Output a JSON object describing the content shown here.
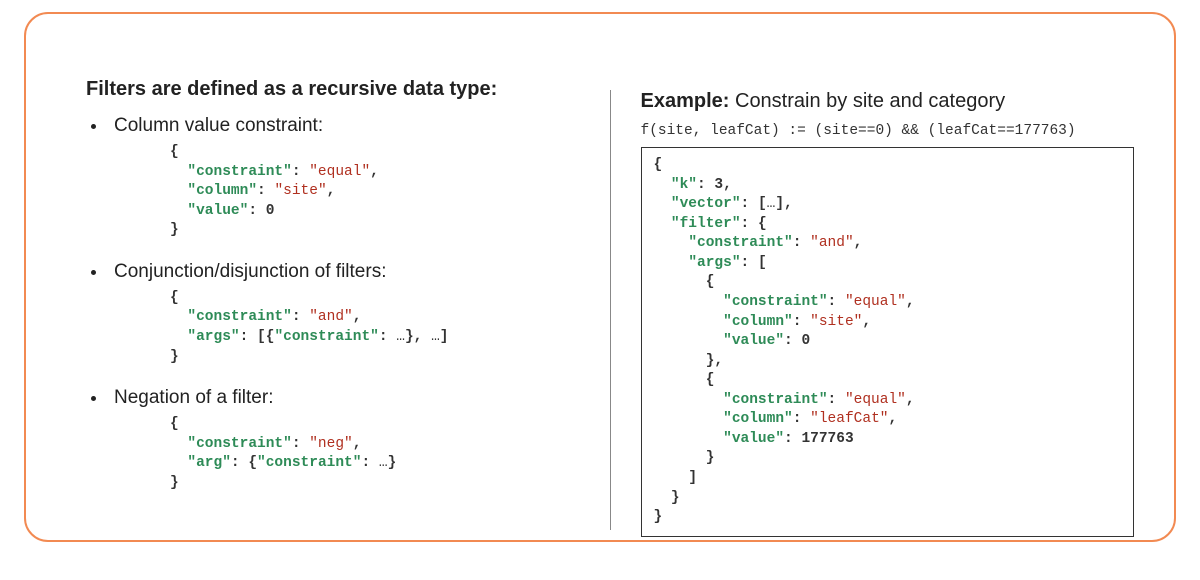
{
  "left": {
    "heading": "Filters are defined as a recursive data type:",
    "items": [
      {
        "label": "Column value constraint:",
        "code": "{\n  \"constraint\": \"equal\",\n  \"column\": \"site\",\n  \"value\": 0\n}"
      },
      {
        "label": "Conjunction/disjunction of filters:",
        "code": "{\n  \"constraint\": \"and\",\n  \"args\": [{\"constraint\": …}, …]\n}"
      },
      {
        "label": "Negation of a filter:",
        "code": "{\n  \"constraint\": \"neg\",\n  \"arg\": {\"constraint\": …}\n}"
      }
    ]
  },
  "right": {
    "heading_bold": "Example:",
    "heading_rest": " Constrain by site and category",
    "formula": "f(site, leafCat) := (site==0) && (leafCat==177763)",
    "example": "{\n  \"k\": 3,\n  \"vector\": […],\n  \"filter\": {\n    \"constraint\": \"and\",\n    \"args\": [\n      {\n        \"constraint\": \"equal\",\n        \"column\": \"site\",\n        \"value\": 0\n      },\n      {\n        \"constraint\": \"equal\",\n        \"column\": \"leafCat\",\n        \"value\": 177763\n      }\n    ]\n  }\n}"
  }
}
